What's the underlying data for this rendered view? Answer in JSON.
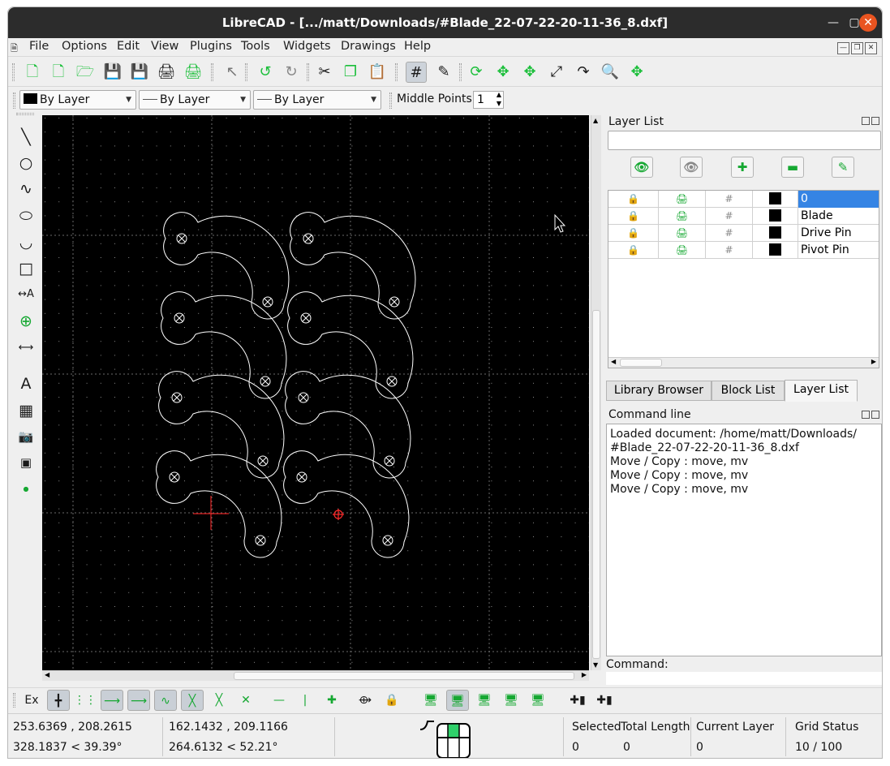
{
  "window": {
    "title": "LibreCAD - [.../matt/Downloads/#Blade_22-07-22-20-11-36_8.dxf]"
  },
  "menu": [
    {
      "label": "File"
    },
    {
      "label": "Options"
    },
    {
      "label": "Edit"
    },
    {
      "label": "View"
    },
    {
      "label": "Plugins"
    },
    {
      "label": "Tools"
    },
    {
      "label": "Widgets"
    },
    {
      "label": "Drawings"
    },
    {
      "label": "Help"
    }
  ],
  "pen": {
    "color": "By Layer",
    "linetype": "By Layer",
    "linewidth": "By Layer"
  },
  "middle_points": {
    "label": "Middle Points",
    "value": "1"
  },
  "layer_panel": {
    "title": "Layer List",
    "filter_value": "",
    "layers": [
      {
        "name": "0"
      },
      {
        "name": "Blade"
      },
      {
        "name": "Drive Pin"
      },
      {
        "name": "Pivot Pin"
      }
    ]
  },
  "tabs": [
    {
      "label": "Library Browser"
    },
    {
      "label": "Block List"
    },
    {
      "label": "Layer List"
    }
  ],
  "command_panel": {
    "title": "Command line",
    "lines": [
      "Loaded document: /home/matt/Downloads/",
      "#Blade_22-07-22-20-11-36_8.dxf",
      "Move / Copy : move, mv",
      "Move / Copy : move, mv",
      "Move / Copy : move, mv"
    ],
    "input_label": "Command:"
  },
  "snap_toolbar": {
    "exclusive_label": "Ex"
  },
  "status": {
    "abs_coord": "253.6369 , 208.2615",
    "abs_polar": "328.1837 < 39.39°",
    "rel_coord": "162.1432 , 209.1166",
    "rel_polar": "264.6132 < 52.21°",
    "selected_label": "Selected",
    "selected_value": "0",
    "total_length_label": "Total Length",
    "total_length_value": "0",
    "current_layer_label": "Current Layer",
    "current_layer_value": "0",
    "grid_status_label": "Grid Status",
    "grid_status_value": "10 / 100"
  },
  "colors": {
    "accent": "#3584e4",
    "close_button": "#e95420",
    "canvas": "#000000",
    "crosshair": "#ff2020"
  }
}
